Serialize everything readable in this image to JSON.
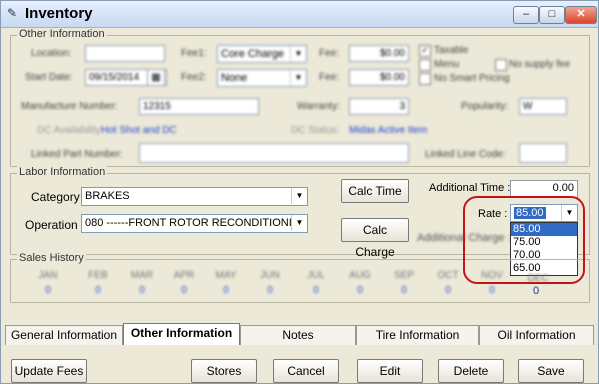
{
  "window": {
    "title": "Inventory",
    "minimize": "–",
    "maximize": "□",
    "close": "✕"
  },
  "other_info": {
    "group_title": "Other Information",
    "location_label": "Location:",
    "start_date_label": "Start Date:",
    "start_date_value": "09/15/2014",
    "fee1_label": "Fee1:",
    "fee1_value": "Core Charge",
    "fee2_label": "Fee2:",
    "fee2_value": "None",
    "fee_label": "Fee:",
    "fee_value_1": "$0.00",
    "fee_value_2": "$0.00",
    "taxable_label": "Taxable",
    "menu_label": "Menu",
    "no_supply_fee_label": "No supply fee",
    "no_smart_pricing_label": "No Smart Pricing",
    "manufacture_number_label": "Manufacture Number:",
    "manufacture_number_value": "12315",
    "warranty_label": "Warranty:",
    "warranty_value": "3",
    "popularity_label": "Popularity:",
    "popularity_value": "W",
    "dc_availability_label": "DC Availability:",
    "dc_availability_value": "Hot Shot and DC",
    "dc_status_label": "DC Status:",
    "dc_status_value": "Midas Active Item",
    "linked_part_label": "Linked Part Number:",
    "linked_line_label": "Linked Line Code:"
  },
  "labor": {
    "group_title": "Labor Information",
    "category_label": "Category :",
    "category_value": "BRAKES",
    "operation_label": "Operation :",
    "operation_value": "080  ------FRONT ROTOR RECONDITIONIN",
    "calc_time": "Calc Time",
    "calc_charge": "Calc Charge",
    "additional_time_label": "Additional Time :",
    "additional_time_value": "0.00",
    "additional_charge_label": "Additional Charge :",
    "rate_label": "Rate :",
    "rate_value": "85.00",
    "rate_options": [
      "85.00",
      "75.00",
      "70.00",
      "65.00"
    ]
  },
  "sales_history": {
    "group_title": "Sales History",
    "months": [
      "JAN",
      "FEB",
      "MAR",
      "APR",
      "MAY",
      "JUN",
      "JUL",
      "AUG",
      "SEP",
      "OCT",
      "NOV",
      "DEC"
    ],
    "values": [
      "0",
      "0",
      "0",
      "0",
      "0",
      "0",
      "0",
      "0",
      "0",
      "0",
      "0",
      "0"
    ]
  },
  "tabs": [
    "General Information",
    "Other Information",
    "Notes",
    "Tire Information",
    "Oil Information"
  ],
  "buttons": {
    "update_fees": "Update Fees",
    "stores": "Stores",
    "cancel": "Cancel",
    "edit": "Edit",
    "delete": "Delete",
    "save": "Save"
  },
  "colors": {
    "highlight_ring": "#c4141a",
    "selection": "#316ac5",
    "link_blue": "#1f3fd1"
  }
}
